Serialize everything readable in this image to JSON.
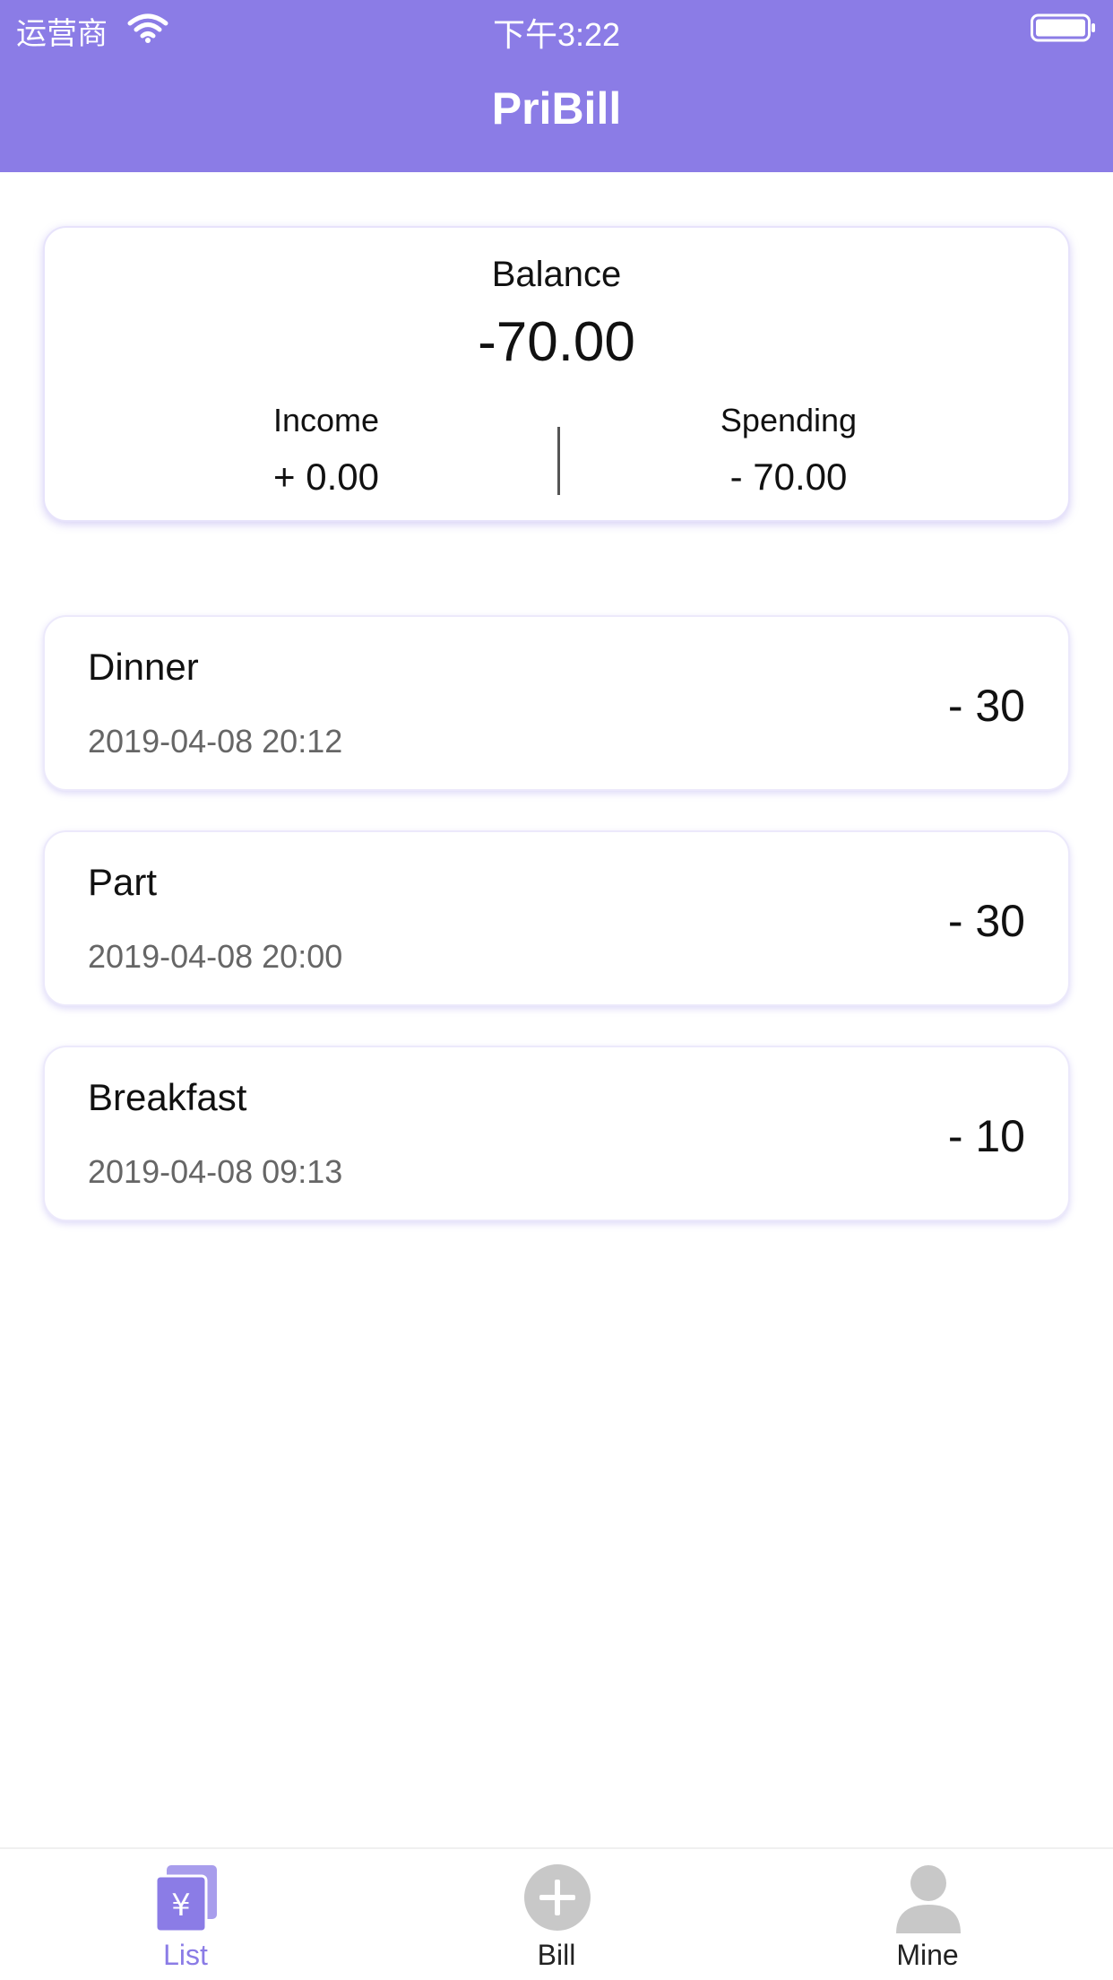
{
  "status_bar": {
    "carrier": "运营商",
    "time": "下午3:22",
    "icons": [
      "wifi-icon",
      "battery-icon"
    ]
  },
  "header": {
    "title": "PriBill"
  },
  "summary": {
    "balance_label": "Balance",
    "balance_value": "-70.00",
    "income_label": "Income",
    "income_value": "+ 0.00",
    "spending_label": "Spending",
    "spending_value": "- 70.00"
  },
  "bills": [
    {
      "name": "Dinner",
      "time": "2019-04-08 20:12",
      "amount": "- 30"
    },
    {
      "name": "Part",
      "time": "2019-04-08 20:00",
      "amount": "- 30"
    },
    {
      "name": "Breakfast",
      "time": "2019-04-08 09:13",
      "amount": "- 10"
    }
  ],
  "tab_bar": {
    "tabs": [
      {
        "label": "List",
        "icon": "yuan-list-icon",
        "active": true
      },
      {
        "label": "Bill",
        "icon": "plus-circle-icon",
        "active": false
      },
      {
        "label": "Mine",
        "icon": "person-icon",
        "active": false
      }
    ]
  },
  "colors": {
    "accent": "#8b7ce6",
    "inactive_icon": "#c8c8c8",
    "text": "#111111",
    "muted_text": "#666666"
  }
}
